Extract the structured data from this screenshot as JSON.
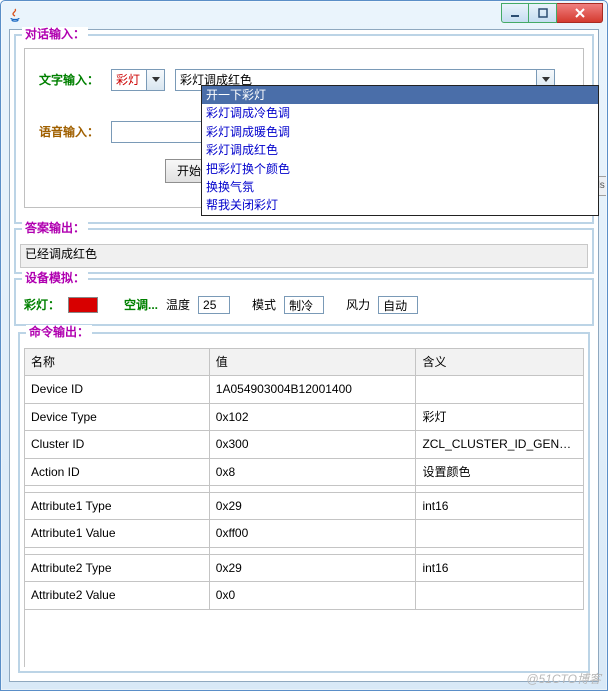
{
  "window": {
    "title": ""
  },
  "dialog_input": {
    "legend": "对话输入：",
    "text_label": "文字输入：",
    "small_combo": "彩灯",
    "big_combo": "彩灯调成红色",
    "voice_label": "语音输入：",
    "voice_value": "",
    "start_button": "开始录",
    "dropdown": {
      "items": [
        "开一下彩灯",
        "彩灯调成冷色调",
        "彩灯调成暖色调",
        "彩灯调成红色",
        "把彩灯换个颜色",
        "换换气氛",
        "帮我关闭彩灯"
      ],
      "selected_index": 0
    }
  },
  "answer": {
    "legend": "答案输出：",
    "text": "已经调成红色"
  },
  "sim": {
    "legend": "设备模拟：",
    "lamp_label": "彩灯：",
    "lamp_color": "#d80000",
    "ac_label": "空调...",
    "temp_label": "温度",
    "temp_value": "25",
    "mode_label": "模式",
    "mode_value": "制冷",
    "wind_label": "风力",
    "wind_value": "自动"
  },
  "side_tab": "ds",
  "cmd": {
    "legend": "命令输出：",
    "headers": [
      "名称",
      "值",
      "含义"
    ],
    "rows": [
      [
        "Device ID",
        "1A054903004B12001400",
        ""
      ],
      [
        "Device Type",
        "0x102",
        "彩灯"
      ],
      [
        "Cluster ID",
        "0x300",
        "ZCL_CLUSTER_ID_GEN_ON_OFF"
      ],
      [
        "Action ID",
        "0x8",
        "设置颜色"
      ],
      [
        "",
        "",
        ""
      ],
      [
        "Attribute1 Type",
        "0x29",
        "int16"
      ],
      [
        "Attribute1 Value",
        "0xff00",
        ""
      ],
      [
        "",
        "",
        ""
      ],
      [
        "Attribute2 Type",
        "0x29",
        "int16"
      ],
      [
        "Attribute2 Value",
        "0x0",
        ""
      ]
    ]
  },
  "watermark": "@51CTO博客"
}
